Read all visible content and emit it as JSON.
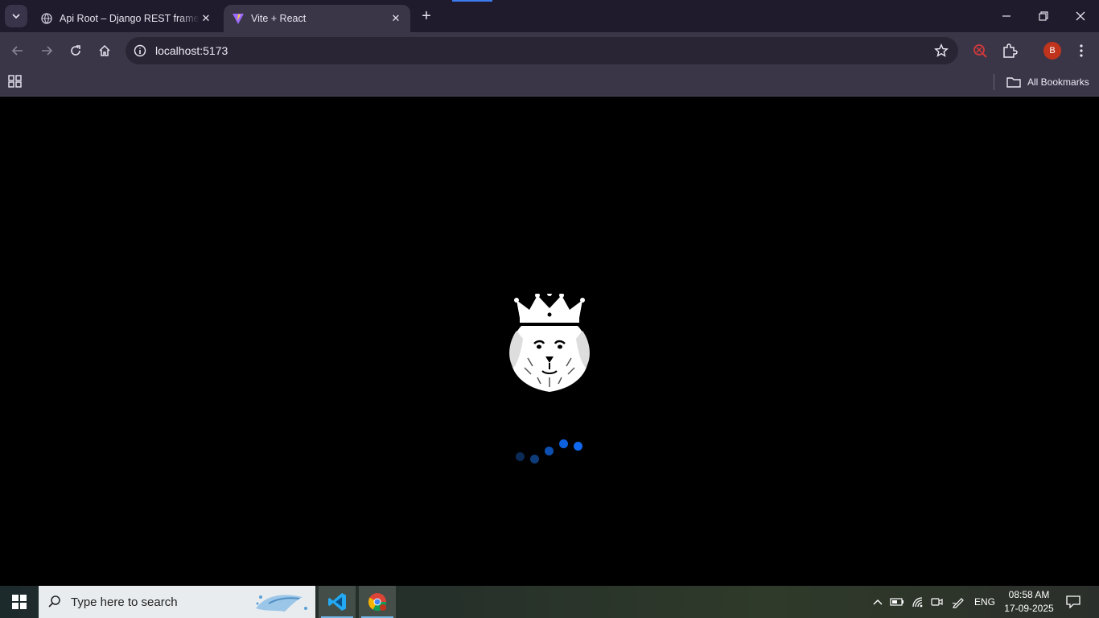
{
  "browser": {
    "tabs": [
      {
        "title": "Api Root – Django REST framework",
        "favicon": "globe-icon",
        "active": false
      },
      {
        "title": "Vite + React",
        "favicon": "vite-icon",
        "active": true
      }
    ],
    "address": "localhost:5173",
    "profile_initial": "B",
    "bookmarks_label": "All Bookmarks"
  },
  "page": {
    "logo": "crowned-dog-logo",
    "loader_colors": [
      "#0b2a55",
      "#0e3c7a",
      "#0d4fb0",
      "#0e62e0",
      "#1168f0"
    ]
  },
  "taskbar": {
    "search_placeholder": "Type here to search",
    "language": "ENG",
    "time": "08:58 AM",
    "date": "17-09-2025",
    "apps": [
      "vscode-icon",
      "chrome-icon"
    ]
  }
}
